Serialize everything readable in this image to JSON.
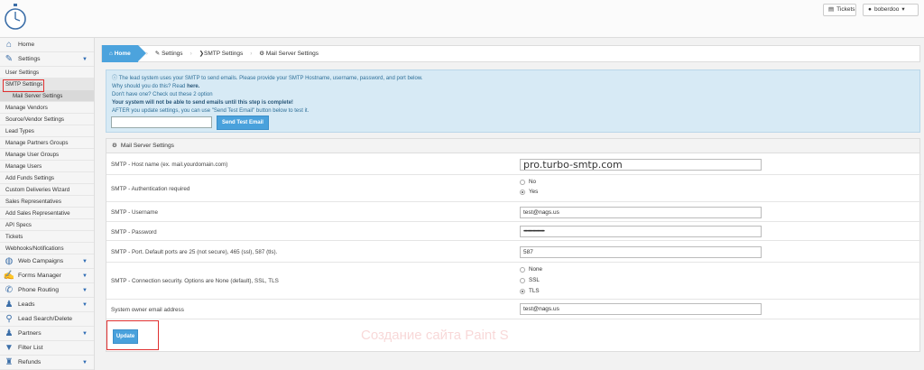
{
  "header": {
    "tickets_label": "Tickets",
    "user_label": "boberdoo"
  },
  "sidebar": {
    "items": [
      {
        "label": "Home"
      },
      {
        "label": "Settings"
      },
      {
        "label": "User Settings"
      },
      {
        "label": "SMTP Settings"
      },
      {
        "label": "Mail Server Settings"
      },
      {
        "label": "Manage Vendors"
      },
      {
        "label": "Source/Vendor Settings"
      },
      {
        "label": "Lead Types"
      },
      {
        "label": "Manage Partners Groups"
      },
      {
        "label": "Manage User Groups"
      },
      {
        "label": "Manage Users"
      },
      {
        "label": "Add Funds Settings"
      },
      {
        "label": "Custom Deliveries Wizard"
      },
      {
        "label": "Sales Representatives"
      },
      {
        "label": "Add Sales Representative"
      },
      {
        "label": "API Specs"
      },
      {
        "label": "Tickets"
      },
      {
        "label": "Webhooks/Notifications"
      },
      {
        "label": "Web Campaigns"
      },
      {
        "label": "Forms Manager"
      },
      {
        "label": "Phone Routing"
      },
      {
        "label": "Leads"
      },
      {
        "label": "Lead Search/Delete"
      },
      {
        "label": "Partners"
      },
      {
        "label": "Filter List"
      },
      {
        "label": "Refunds"
      }
    ]
  },
  "breadcrumb": [
    "Home",
    "Settings",
    "SMTP Settings",
    "Mail Server Settings"
  ],
  "info": {
    "line1": "The lead system uses your SMTP to send emails. Please provide your SMTP Hostname, username, password, and port below.",
    "line2a": "Why should you do this? Read ",
    "line2b": "here.",
    "line3": "Don't have one? Check out these 2 option",
    "line4": "Your system will not be able to send emails until this step is complete!",
    "line5": "AFTER you update settings, you can use \"Send Test Email\" button below to test it.",
    "test_button": "Send Test Email"
  },
  "panel": {
    "title": "Mail Server Settings",
    "fields": {
      "host_label": "SMTP - Host name (ex. mail.yourdomain.com)",
      "host_value": "pro.turbo-smtp.com",
      "auth_label": "SMTP - Authentication required",
      "auth_no": "No",
      "auth_yes": "Yes",
      "user_label": "SMTP - Username",
      "user_value": "test@nags.us",
      "pass_label": "SMTP - Password",
      "pass_value": "••••••••••••••••••",
      "port_label": "SMTP - Port. Default ports are 25 (not secure), 465 (ssl), 587 (tls).",
      "port_value": "587",
      "sec_label": "SMTP - Connection security. Options are None (default), SSL, TLS",
      "sec_none": "None",
      "sec_ssl": "SSL",
      "sec_tls": "TLS",
      "owner_label": "System owner email address",
      "owner_value": "test@nags.us"
    },
    "update_button": "Update"
  },
  "watermark": "Создание сайта Paint S",
  "colors": {
    "accent": "#4ca3dd",
    "info_bg": "#d7eaf5",
    "highlight": "#e03030"
  }
}
